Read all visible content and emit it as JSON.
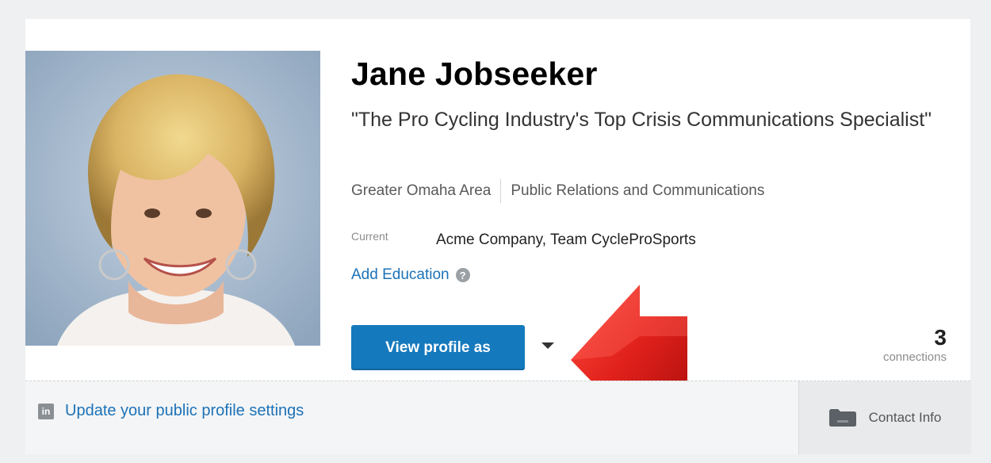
{
  "profile": {
    "name": "Jane Jobseeker",
    "headline": "\"The Pro Cycling Industry's Top Crisis Communications Specialist\"",
    "location": "Greater Omaha Area",
    "industry": "Public Relations and Communications",
    "current_label": "Current",
    "current_value": "Acme Company, Team CycleProSports",
    "add_education": "Add Education",
    "help_icon_glyph": "?"
  },
  "actions": {
    "view_profile_label": "View profile as",
    "connections_count": "3",
    "connections_label": "connections"
  },
  "footer": {
    "public_profile_label": "Update your public profile settings",
    "linkedin_icon_glyph": "in",
    "contact_info_label": "Contact Info"
  },
  "icons": {
    "photo": "profile-photo",
    "help": "help-icon",
    "dropdown": "chevron-down-icon",
    "annotation": "red-arrow-icon",
    "linkedin": "linkedin-icon",
    "contact": "folder-icon"
  },
  "colors": {
    "accent": "#1579bd",
    "link": "#1c72b8",
    "arrow": "#e0201b"
  }
}
